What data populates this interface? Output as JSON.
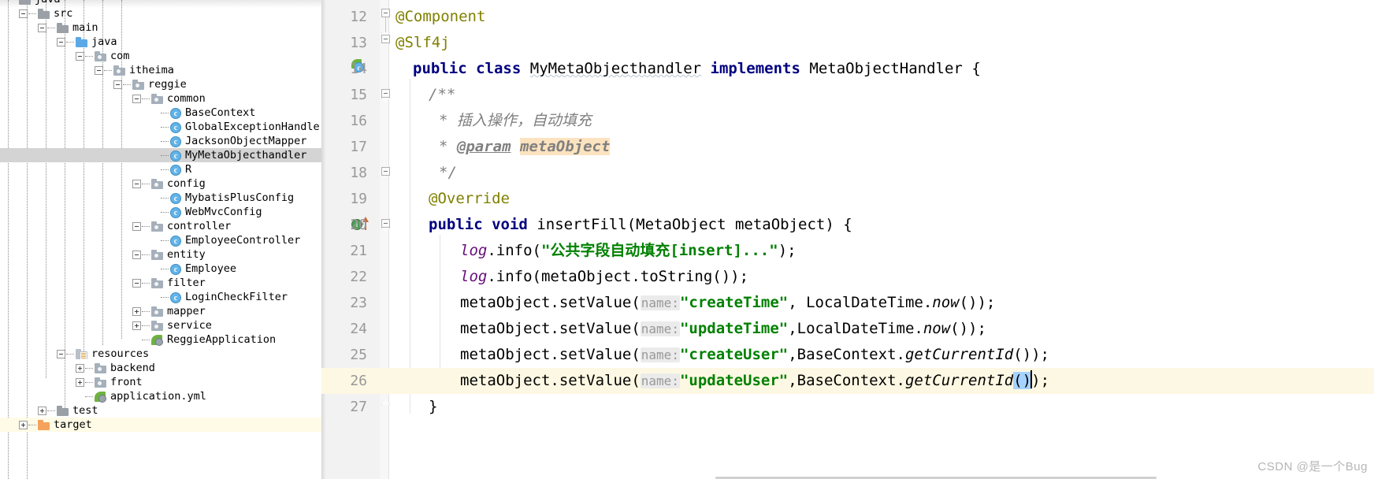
{
  "project_tree": {
    "rows": [
      {
        "label": "java",
        "depth": 0,
        "toggle": "none",
        "icon": "folder-gray",
        "state": "normal",
        "partial": true
      },
      {
        "label": "src",
        "depth": 1,
        "toggle": "minus",
        "icon": "folder-gray",
        "state": "normal"
      },
      {
        "label": "main",
        "depth": 2,
        "toggle": "minus",
        "icon": "folder-gray",
        "state": "normal"
      },
      {
        "label": "java",
        "depth": 3,
        "toggle": "minus",
        "icon": "folder-blue",
        "state": "normal"
      },
      {
        "label": "com",
        "depth": 4,
        "toggle": "minus",
        "icon": "folder-pkg",
        "state": "normal"
      },
      {
        "label": "itheima",
        "depth": 5,
        "toggle": "minus",
        "icon": "folder-pkg",
        "state": "normal"
      },
      {
        "label": "reggie",
        "depth": 6,
        "toggle": "minus",
        "icon": "folder-pkg",
        "state": "normal"
      },
      {
        "label": "common",
        "depth": 7,
        "toggle": "minus",
        "icon": "folder-pkg",
        "state": "normal"
      },
      {
        "label": "BaseContext",
        "depth": 8,
        "toggle": "none",
        "icon": "class-c",
        "state": "normal"
      },
      {
        "label": "GlobalExceptionHandler",
        "depth": 8,
        "toggle": "none",
        "icon": "class-c",
        "state": "normal"
      },
      {
        "label": "JacksonObjectMapper",
        "depth": 8,
        "toggle": "none",
        "icon": "class-c",
        "state": "normal"
      },
      {
        "label": "MyMetaObjecthandler",
        "depth": 8,
        "toggle": "none",
        "icon": "class-c",
        "state": "selected"
      },
      {
        "label": "R",
        "depth": 8,
        "toggle": "none",
        "icon": "class-c",
        "state": "normal"
      },
      {
        "label": "config",
        "depth": 7,
        "toggle": "minus",
        "icon": "folder-pkg",
        "state": "normal"
      },
      {
        "label": "MybatisPlusConfig",
        "depth": 8,
        "toggle": "none",
        "icon": "class-c",
        "state": "normal"
      },
      {
        "label": "WebMvcConfig",
        "depth": 8,
        "toggle": "none",
        "icon": "class-c",
        "state": "normal"
      },
      {
        "label": "controller",
        "depth": 7,
        "toggle": "minus",
        "icon": "folder-pkg",
        "state": "normal"
      },
      {
        "label": "EmployeeController",
        "depth": 8,
        "toggle": "none",
        "icon": "class-c",
        "state": "normal"
      },
      {
        "label": "entity",
        "depth": 7,
        "toggle": "minus",
        "icon": "folder-pkg",
        "state": "normal"
      },
      {
        "label": "Employee",
        "depth": 8,
        "toggle": "none",
        "icon": "class-c",
        "state": "normal"
      },
      {
        "label": "filter",
        "depth": 7,
        "toggle": "minus",
        "icon": "folder-pkg",
        "state": "normal"
      },
      {
        "label": "LoginCheckFilter",
        "depth": 8,
        "toggle": "none",
        "icon": "class-c",
        "state": "normal"
      },
      {
        "label": "mapper",
        "depth": 7,
        "toggle": "plus",
        "icon": "folder-pkg",
        "state": "normal"
      },
      {
        "label": "service",
        "depth": 7,
        "toggle": "plus",
        "icon": "folder-pkg",
        "state": "normal"
      },
      {
        "label": "ReggieApplication",
        "depth": 7,
        "toggle": "none",
        "icon": "spring-app",
        "state": "normal"
      },
      {
        "label": "resources",
        "depth": 3,
        "toggle": "minus",
        "icon": "folder-res",
        "state": "normal"
      },
      {
        "label": "backend",
        "depth": 4,
        "toggle": "plus",
        "icon": "folder-pkg",
        "state": "normal"
      },
      {
        "label": "front",
        "depth": 4,
        "toggle": "plus",
        "icon": "folder-pkg",
        "state": "normal"
      },
      {
        "label": "application.yml",
        "depth": 4,
        "toggle": "none",
        "icon": "yml-leaf",
        "state": "normal"
      },
      {
        "label": "test",
        "depth": 2,
        "toggle": "plus",
        "icon": "folder-gray",
        "state": "normal"
      },
      {
        "label": "target",
        "depth": 1,
        "toggle": "plus",
        "icon": "folder-orange",
        "state": "target-row"
      }
    ]
  },
  "editor": {
    "lines": [
      {
        "num": "12",
        "current": false
      },
      {
        "num": "13",
        "current": false
      },
      {
        "num": "14",
        "current": false
      },
      {
        "num": "15",
        "current": false
      },
      {
        "num": "16",
        "current": false
      },
      {
        "num": "17",
        "current": false
      },
      {
        "num": "18",
        "current": false
      },
      {
        "num": "19",
        "current": false
      },
      {
        "num": "20",
        "current": false
      },
      {
        "num": "21",
        "current": false
      },
      {
        "num": "22",
        "current": false
      },
      {
        "num": "23",
        "current": false
      },
      {
        "num": "24",
        "current": false
      },
      {
        "num": "25",
        "current": false
      },
      {
        "num": "26",
        "current": true
      },
      {
        "num": "27",
        "current": false
      }
    ],
    "code": {
      "l12_annotation": "@Component",
      "l13_annotation": "@Slf4j",
      "l14_kw_public": "public",
      "l14_kw_class": "class",
      "l14_classname": "MyMetaObjecthandler",
      "l14_kw_implements": "implements",
      "l14_iface": "MetaObjectHandler",
      "l14_brace": "{",
      "l15_comment": "/**",
      "l16_comment": "* 插入操作，自动填充",
      "l17_star": "*",
      "l17_param_tag": "@param",
      "l17_param_name": "metaObject",
      "l18_comment": "*/",
      "l19_annotation": "@Override",
      "l20_kw_public": "public",
      "l20_kw_void": "void",
      "l20_method": "insertFill(MetaObject metaObject)",
      "l20_brace": "{",
      "l21_log": "log",
      "l21_call": ".info(",
      "l21_str": "\"公共字段自动填充[insert]...\"",
      "l21_end": ");",
      "l22_log": "log",
      "l22_call": ".info(metaObject.toString());",
      "l23_prefix": "metaObject.setValue(",
      "l23_hint": "name:",
      "l23_str": "\"createTime\"",
      "l23_mid": ", LocalDateTime.",
      "l23_method": "now",
      "l23_end": "());",
      "l24_prefix": "metaObject.setValue(",
      "l24_hint": "name:",
      "l24_str": "\"updateTime\"",
      "l24_mid": ",LocalDateTime.",
      "l24_method": "now",
      "l24_end": "());",
      "l25_prefix": "metaObject.setValue(",
      "l25_hint": "name:",
      "l25_str": "\"createUser\"",
      "l25_mid": ",BaseContext.",
      "l25_method": "getCurrentId",
      "l25_end": "());",
      "l26_prefix": "metaObject.setValue(",
      "l26_hint": "name:",
      "l26_str": "\"updateUser\"",
      "l26_mid": ",BaseContext.",
      "l26_method": "getCurrentId",
      "l26_brackets": "()",
      "l26_end": ");",
      "l27_brace": "}"
    }
  },
  "watermark": {
    "text": "CSDN @是一个Bug"
  },
  "colors": {
    "keyword": "#000080",
    "annotation": "#808000",
    "string": "#008000",
    "comment": "#808080",
    "field_italic": "#660e7a",
    "current_line": "#fdf8e3",
    "selected_tree_row": "#d4d4d4",
    "param_highlight": "#fce3bf",
    "bracket_match": "#a6d2ff",
    "gutter_bg": "#f2f2f2"
  }
}
